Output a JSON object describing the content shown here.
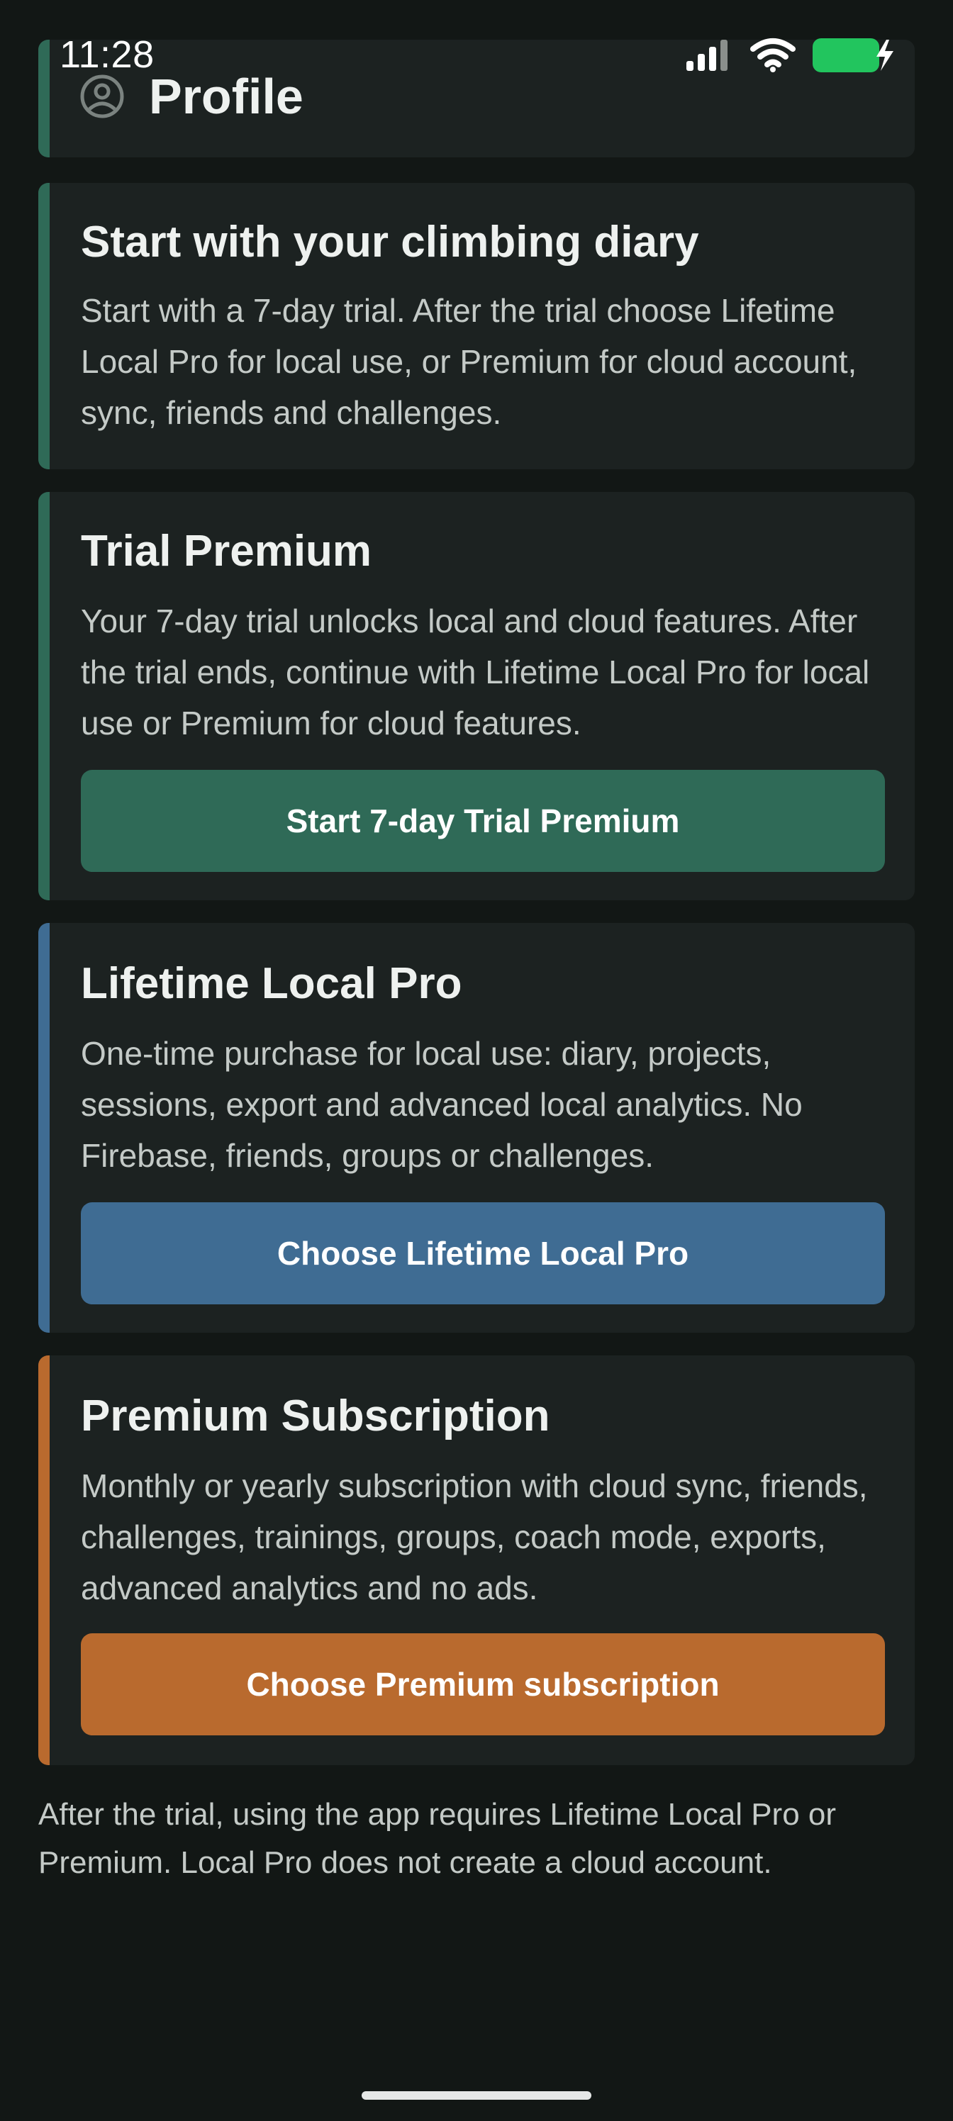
{
  "status_bar": {
    "time": "11:28",
    "icons": [
      "signal-icon",
      "wifi-icon",
      "battery-charging-icon"
    ],
    "battery_color": "#22c55e"
  },
  "header": {
    "title": "Profile",
    "icon": "profile-circle-icon"
  },
  "cards": [
    {
      "title": "Start with your climbing diary",
      "body": "Start with a 7-day trial. After the trial choose Lifetime Local Pro for local use, or Premium for cloud account, sync, friends and challenges.",
      "accent_color": "#2f6a57"
    },
    {
      "title": "Trial Premium",
      "body": "Your 7-day trial unlocks local and cloud features. After the trial ends, continue with Lifetime Local Pro for local use or Premium for cloud features.",
      "button_label": "Start 7-day Trial Premium",
      "accent_color": "#2f6a57"
    },
    {
      "title": "Lifetime Local Pro",
      "body": "One-time purchase for local use: diary, projects, sessions, export and advanced local analytics. No Firebase, friends, groups or challenges.",
      "button_label": "Choose Lifetime Local Pro",
      "accent_color": "#3f6c93"
    },
    {
      "title": "Premium Subscription",
      "body": "Monthly or yearly subscription with cloud sync, friends, challenges, trainings, groups, coach mode, exports, advanced analytics and no ads.",
      "button_label": "Choose Premium subscription",
      "accent_color": "#b96a2e"
    }
  ],
  "footer_note": "After the trial, using the app requires Lifetime Local Pro or Premium. Local Pro does not create a cloud account."
}
